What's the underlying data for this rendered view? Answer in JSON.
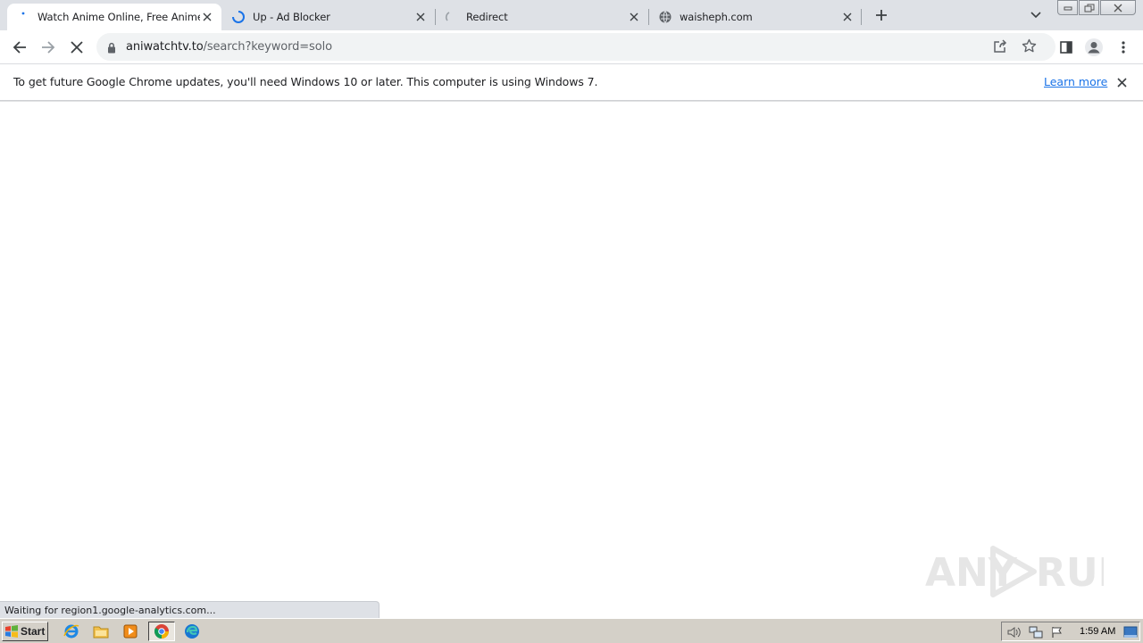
{
  "browser": {
    "tabs": [
      {
        "title": "Watch Anime Online, Free Anime Str",
        "icon": "loading-dots-icon",
        "active": true
      },
      {
        "title": "Up - Ad Blocker",
        "icon": "loading-spinner-icon",
        "active": false
      },
      {
        "title": "Redirect",
        "icon": "loading-spinner-icon",
        "active": false
      },
      {
        "title": "waisheph.com",
        "icon": "globe-icon",
        "active": false
      }
    ],
    "address": {
      "domain": "aniwatchtv.to",
      "path": "/search?keyword=solo"
    },
    "infobar": {
      "message": "To get future Google Chrome updates, you'll need Windows 10 or later. This computer is using Windows 7.",
      "link": "Learn more"
    },
    "status_text": "Waiting for region1.google-analytics.com..."
  },
  "watermark": {
    "text_left": "ANY",
    "text_right": "RUN"
  },
  "taskbar": {
    "start_label": "Start",
    "apps": [
      "internet-explorer-icon",
      "file-explorer-icon",
      "media-player-icon",
      "chrome-icon",
      "edge-icon"
    ],
    "clock": "1:59 AM"
  },
  "colors": {
    "tabstrip": "#dee1e6",
    "omnibox": "#f1f3f4",
    "link": "#1a73e8",
    "taskbar": "#d4d0c8"
  }
}
